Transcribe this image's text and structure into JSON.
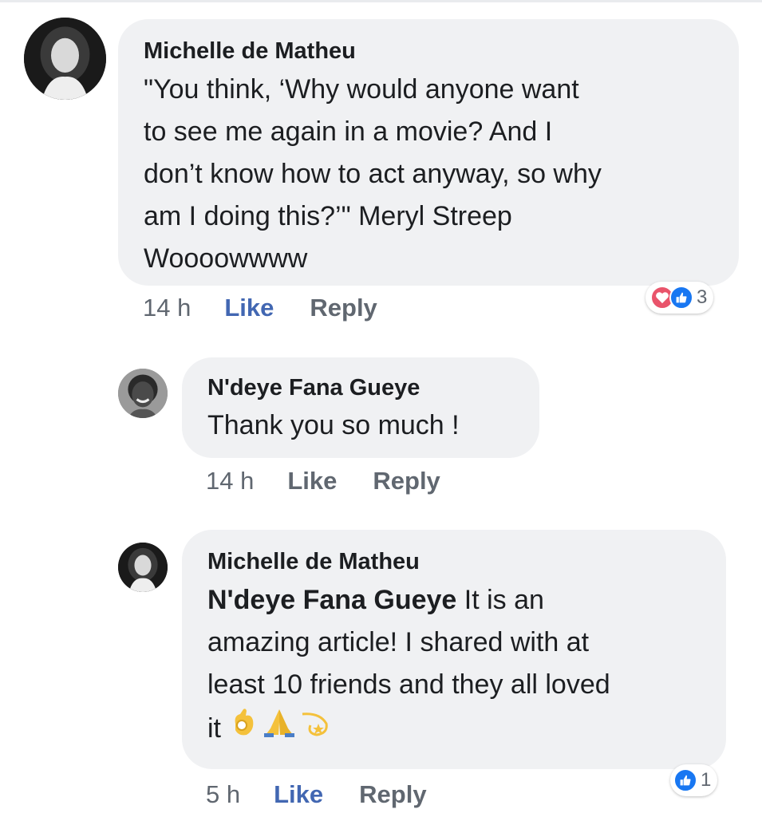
{
  "comments": [
    {
      "author": "Michelle de Matheu",
      "lines": [
        "\"You think, ‘Why would anyone want",
        "to see me again in a movie? And I",
        "don’t know how to act anyway, so why",
        "am I doing this?’\" Meryl Streep",
        "Woooowwww"
      ],
      "time": "14 h",
      "like_label": "Like",
      "reply_label": "Reply",
      "reaction_count": "3",
      "reaction_icons": [
        "heart-icon",
        "thumbs-up-icon"
      ]
    },
    {
      "author": "N'deye Fana Gueye",
      "lines": [
        "Thank you so much !"
      ],
      "time": "14 h",
      "like_label": "Like",
      "reply_label": "Reply"
    },
    {
      "author": "Michelle de Matheu",
      "mention": "N'deye Fana Gueye",
      "lines": [
        " It is an",
        "amazing article! I shared with at",
        "least 10 friends and they all loved",
        "it"
      ],
      "emojis": [
        "ok-hand-icon",
        "folded-hands-icon",
        "dizzy-star-icon"
      ],
      "time": "5 h",
      "like_label": "Like",
      "reply_label": "Reply",
      "reaction_count": "1",
      "reaction_icons": [
        "thumbs-up-icon"
      ]
    }
  ],
  "colors": {
    "bubble": "#f0f1f3",
    "like_blue": "#4267b2",
    "meta_gray": "#606770",
    "love_red": "#e9546b",
    "reaction_blue": "#1877f2"
  }
}
